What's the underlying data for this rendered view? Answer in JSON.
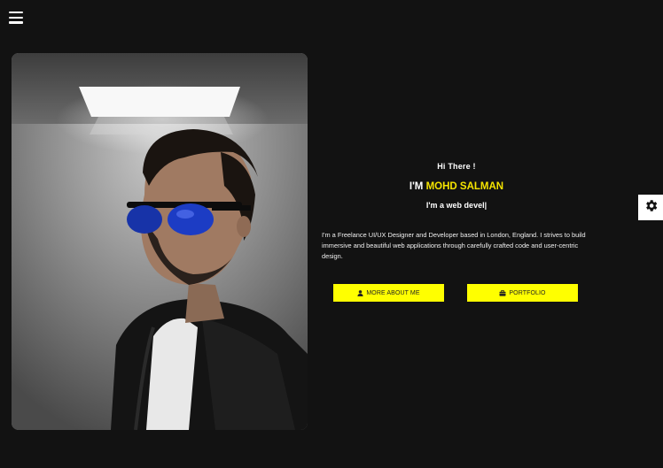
{
  "nav": {
    "menu_icon": "hamburger-icon"
  },
  "hero": {
    "greeting": "Hi There !",
    "name_prefix": "I'M ",
    "name": "MOHD SALMAN",
    "role": "I'm a web devel|",
    "bio": "I'm a Freelance UI/UX Designer and Developer based in London, England. I strives to build immersive and beautiful web applications through carefully crafted code and user-centric design."
  },
  "buttons": {
    "about_label": "MORE ABOUT ME",
    "about_icon": "user-icon",
    "portfolio_label": "PORTFOLIO",
    "portfolio_icon": "briefcase-icon"
  },
  "settings": {
    "icon": "gear-icon"
  },
  "colors": {
    "background": "#121212",
    "accent": "#ffff00",
    "name_highlight": "#f5e400",
    "text": "#ffffff"
  }
}
